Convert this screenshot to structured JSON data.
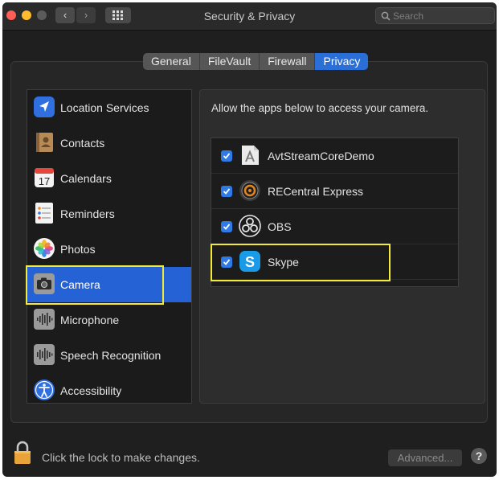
{
  "window": {
    "title": "Security & Privacy"
  },
  "toolbar": {
    "back_glyph": "‹",
    "forward_glyph": "›",
    "search_placeholder": "Search"
  },
  "tabs": [
    {
      "label": "General",
      "active": false
    },
    {
      "label": "FileVault",
      "active": false
    },
    {
      "label": "Firewall",
      "active": false
    },
    {
      "label": "Privacy",
      "active": true
    }
  ],
  "sidebar": {
    "items": [
      {
        "label": "Location Services",
        "icon": "location-arrow-icon"
      },
      {
        "label": "Contacts",
        "icon": "contacts-book-icon"
      },
      {
        "label": "Calendars",
        "icon": "calendar-icon",
        "icon_text": "17"
      },
      {
        "label": "Reminders",
        "icon": "reminders-list-icon"
      },
      {
        "label": "Photos",
        "icon": "photos-flower-icon"
      },
      {
        "label": "Camera",
        "icon": "camera-icon",
        "selected": true
      },
      {
        "label": "Microphone",
        "icon": "microphone-waveform-icon"
      },
      {
        "label": "Speech Recognition",
        "icon": "speech-waveform-icon"
      },
      {
        "label": "Accessibility",
        "icon": "accessibility-person-icon"
      }
    ]
  },
  "main": {
    "instruction": "Allow the apps below to access your camera.",
    "apps": [
      {
        "name": "AvtStreamCoreDemo",
        "checked": true,
        "icon": "avtstream-app-icon"
      },
      {
        "name": "RECentral Express",
        "checked": true,
        "icon": "recentral-app-icon"
      },
      {
        "name": "OBS",
        "checked": true,
        "icon": "obs-app-icon"
      },
      {
        "name": "Skype",
        "checked": true,
        "icon": "skype-app-icon"
      }
    ]
  },
  "footer": {
    "lock_text": "Click the lock to make changes.",
    "advanced_label": "Advanced...",
    "help_label": "?"
  },
  "colors": {
    "accent": "#2462d6",
    "checkbox": "#2f7ae5",
    "highlight": "#f2ea3a",
    "close": "#ff5f57",
    "minimize": "#febc2e"
  }
}
